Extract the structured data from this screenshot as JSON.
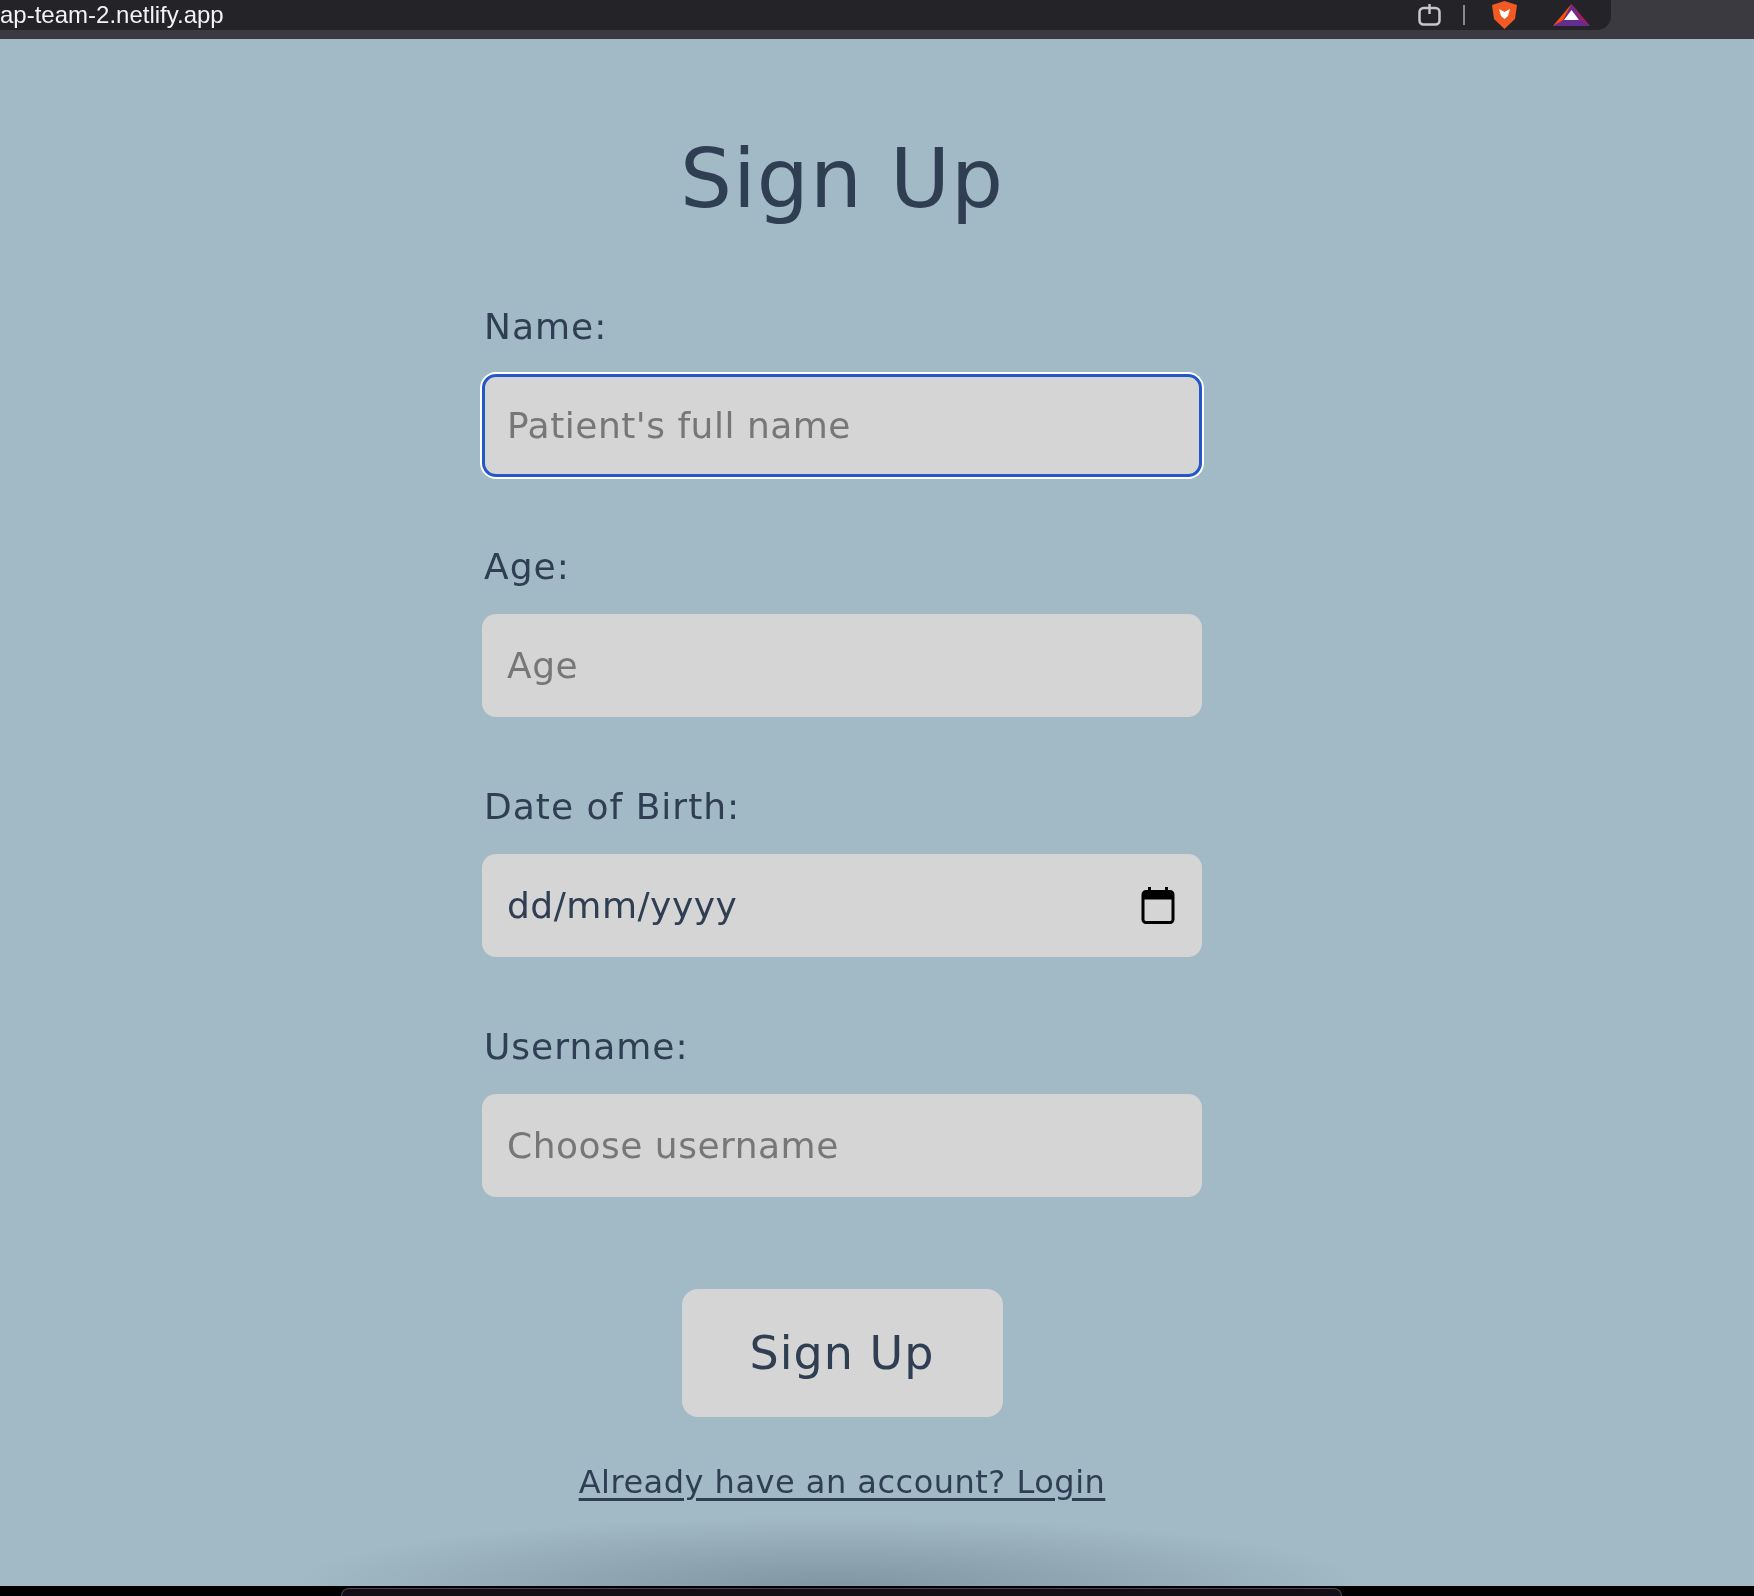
{
  "browser": {
    "address": "ap-team-2.netlify.app"
  },
  "title": "Sign Up",
  "fields": [
    {
      "kind": "text",
      "label": "Name:",
      "placeholder": "Patient's full name",
      "focused": true
    },
    {
      "kind": "text",
      "label": "Age:",
      "placeholder": "Age",
      "focused": false
    },
    {
      "kind": "date",
      "label": "Date of Birth:",
      "placeholder": "dd/mm/yyyy",
      "focused": false
    },
    {
      "kind": "text",
      "label": "Username:",
      "placeholder": "Choose username",
      "focused": false
    }
  ],
  "submit_button": "Sign Up",
  "login_link": "Already have an account? Login"
}
